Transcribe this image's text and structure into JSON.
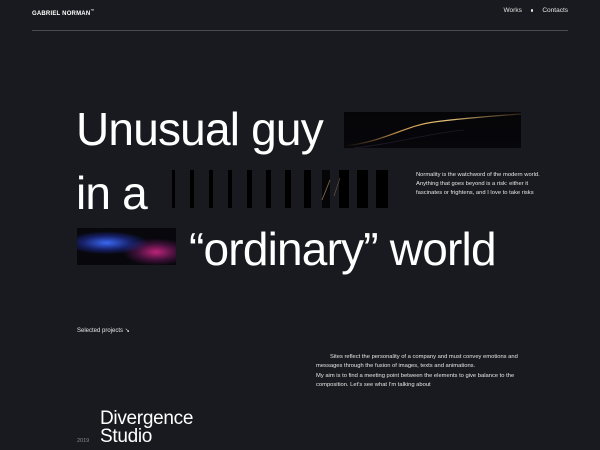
{
  "header": {
    "brand": "GABRIEL NORMAN",
    "brand_mark": "™",
    "nav": [
      {
        "label": "Works"
      },
      {
        "label": "Contacts"
      }
    ]
  },
  "hero": {
    "line1": "Unusual guy",
    "line2": "in a",
    "line3": "“ordinary” world"
  },
  "description": "Normality is the watchword of the modern world. Anything that goes beyond is a risk: either it fascinates or frightens, and I love to take risks",
  "selected_projects": "Selected projects ↘",
  "intro": {
    "p1": "Sites reflect the personality of a company and must convey emotions and messages through the fusion of images, texts and animations.",
    "p2": "My aim is to find a meeting point between the elements to give balance to the composition. Let's see what I'm talking about"
  },
  "project": {
    "year": "2019",
    "title_line1": "Divergence",
    "title_line2": "Studio"
  },
  "colors": {
    "background": "#191a1f",
    "text": "#ffffff",
    "divider": "#4a4b52"
  }
}
